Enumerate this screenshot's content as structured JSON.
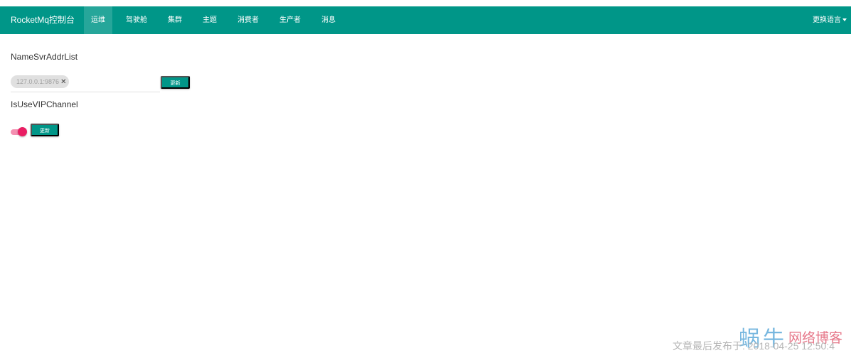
{
  "navbar": {
    "brand": "RocketMq控制台",
    "items": [
      {
        "label": "运维",
        "active": true
      },
      {
        "label": "驾驶舱",
        "active": false
      },
      {
        "label": "集群",
        "active": false
      },
      {
        "label": "主题",
        "active": false
      },
      {
        "label": "消费者",
        "active": false
      },
      {
        "label": "生产者",
        "active": false
      },
      {
        "label": "消息",
        "active": false
      }
    ],
    "language_switch": "更换语言"
  },
  "ops": {
    "namesrv_label": "NameSvrAddrList",
    "namesrv_chips": [
      "127.0.0.1:9876"
    ],
    "namesrv_update_label": "更新",
    "vip_label": "IsUseVIPChannel",
    "vip_enabled": true,
    "vip_update_label": "更新"
  },
  "watermark": {
    "logo": "蜗牛",
    "name": "网络博客",
    "published": "文章最后发布于: 2018-04-25 12:50:4"
  },
  "colors": {
    "primary": "#009688",
    "active_tab": "#26a69a",
    "toggle_thumb": "#e91e63",
    "toggle_track": "#f48fb1"
  }
}
